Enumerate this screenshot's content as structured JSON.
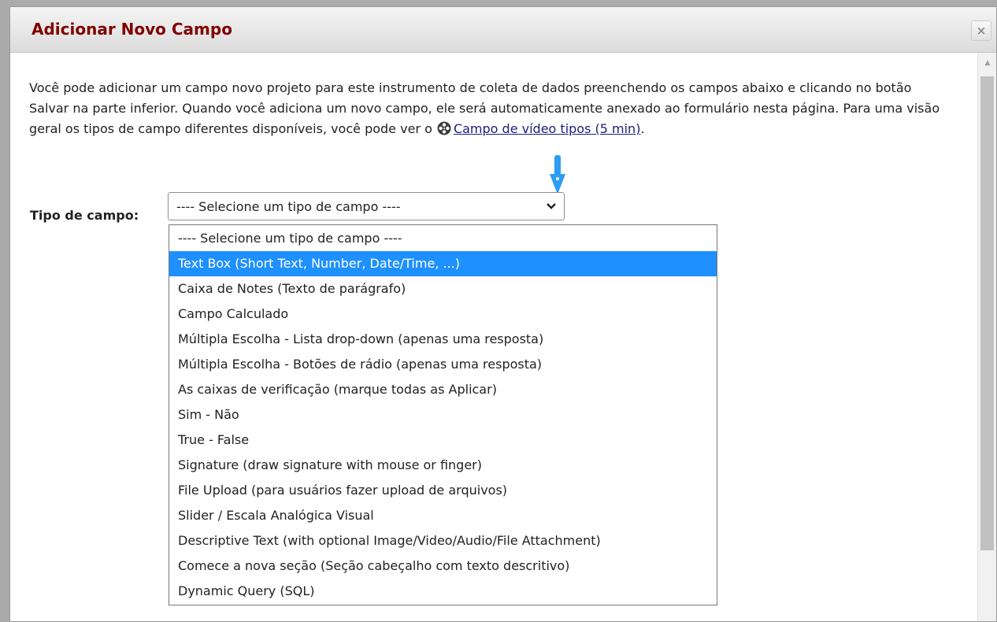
{
  "dialog": {
    "title": "Adicionar Novo Campo",
    "close_icon": "close-icon",
    "close_label": "×"
  },
  "intro": {
    "text": "Você pode adicionar um campo novo projeto para este instrumento de coleta de dados preenchendo os campos abaixo e clicando no botão Salvar na parte inferior. Quando você adiciona um novo campo, ele será automaticamente anexado ao formulário nesta página. Para uma visão geral os tipos de campo diferentes disponíveis, você pode ver o",
    "video_icon": "film-reel-icon",
    "video_link": "Campo de vídeo tipos (5 min)",
    "after_link": "."
  },
  "field_type": {
    "label": "Tipo de campo:",
    "selected": "---- Selecione um tipo de campo ----",
    "chevron_icon": "chevron-down-icon",
    "options": [
      "---- Selecione um tipo de campo ----",
      "Text Box (Short Text, Number, Date/Time, ...)",
      "Caixa de Notes (Texto de parágrafo)",
      "Campo Calculado",
      "Múltipla Escolha - Lista drop-down (apenas uma resposta)",
      "Múltipla Escolha - Botões de rádio (apenas uma resposta)",
      "As caixas de verificação (marque todas as Aplicar)",
      "Sim - Não",
      "True - False",
      "Signature (draw signature with mouse or finger)",
      "File Upload (para usuários fazer upload de arquivos)",
      "Slider / Escala Analógica Visual",
      "Descriptive Text (with optional Image/Video/Audio/File Attachment)",
      "Comece a nova seção (Seção cabeçalho com texto descritivo)",
      "Dynamic Query (SQL)"
    ],
    "highlighted_index": 1
  },
  "annotation": {
    "arrow_icon": "down-arrow-icon"
  },
  "colors": {
    "title": "#800000",
    "highlight": "#1e90ff",
    "arrow": "#2a9df4",
    "link": "#1d1d7a"
  }
}
